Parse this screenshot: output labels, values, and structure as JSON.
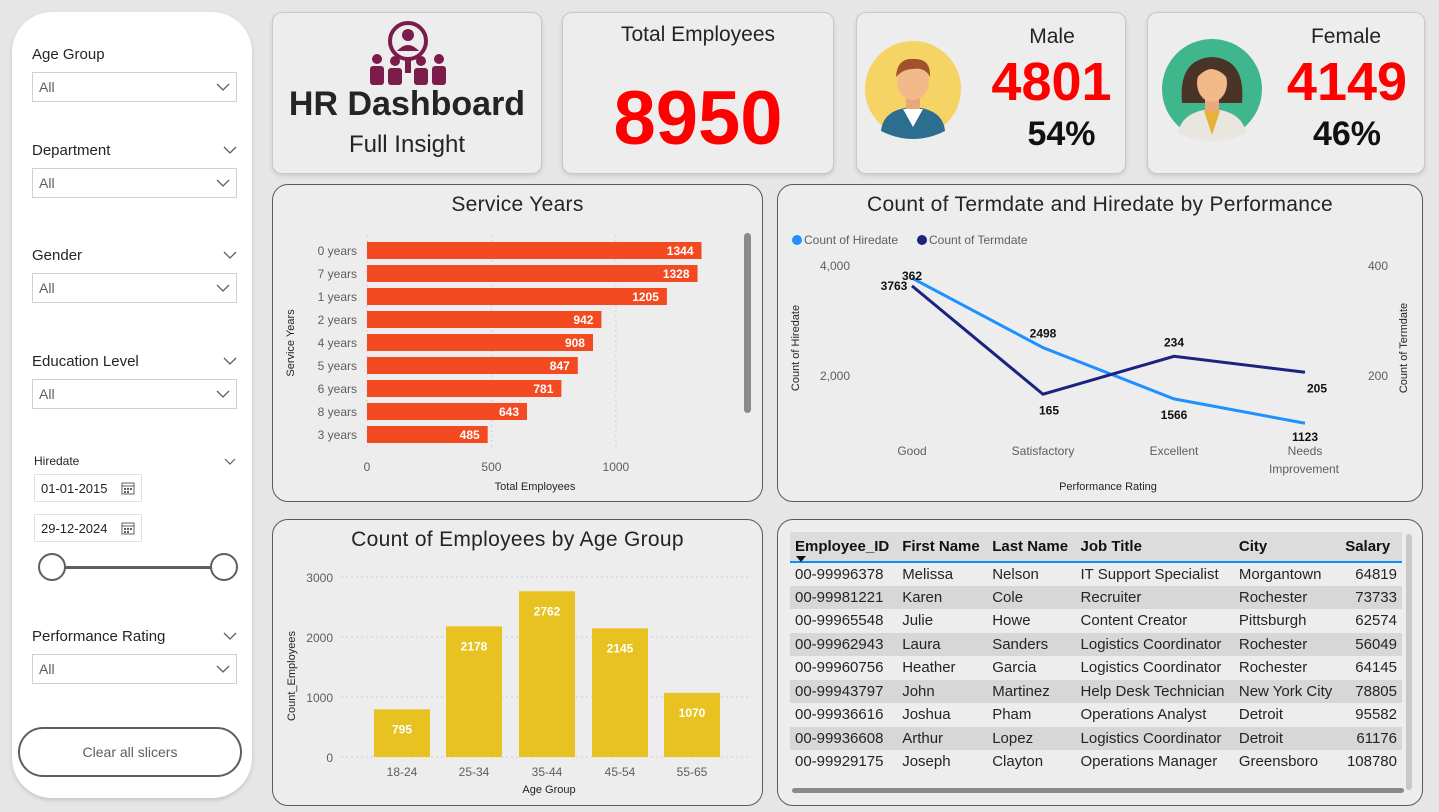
{
  "filters": {
    "age_group": {
      "label": "Age Group",
      "value": "All"
    },
    "department": {
      "label": "Department",
      "value": "All"
    },
    "gender": {
      "label": "Gender",
      "value": "All"
    },
    "education_level": {
      "label": "Education Level",
      "value": "All"
    },
    "hiredate": {
      "label": "Hiredate",
      "start": "01-01-2015",
      "end": "29-12-2024"
    },
    "performance_rating": {
      "label": "Performance Rating",
      "value": "All"
    },
    "clear_label": "Clear all slicers"
  },
  "header": {
    "title": "HR Dashboard",
    "subtitle": "Full Insight",
    "total_label": "Total Employees",
    "total_value": "8950",
    "male_label": "Male",
    "male_value": "4801",
    "male_pct": "54%",
    "female_label": "Female",
    "female_value": "4149",
    "female_pct": "46%"
  },
  "colors": {
    "bar_orange": "#f44a22",
    "bar_yellow": "#e8c220",
    "line_light": "#1e90ff",
    "line_dark": "#1a237e",
    "kpi_red": "#ff0000"
  },
  "chart_data": [
    {
      "type": "bar",
      "orientation": "horizontal",
      "title": "Service Years",
      "xlabel": "Total Employees",
      "ylabel": "Service Years",
      "categories": [
        "0 years",
        "7 years",
        "1 years",
        "2 years",
        "4 years",
        "5 years",
        "6 years",
        "8 years",
        "3 years"
      ],
      "values": [
        1344,
        1328,
        1205,
        942,
        908,
        847,
        781,
        643,
        485
      ],
      "xticks": [
        "0",
        "500",
        "1000"
      ],
      "xlim": [
        0,
        1350
      ]
    },
    {
      "type": "line",
      "title": "Count of Termdate and Hiredate by Performance",
      "xlabel": "Performance Rating",
      "ylabel": "Count of Hiredate",
      "y2label": "Count of Termdate",
      "categories": [
        "Good",
        "Satisfactory",
        "Excellent",
        "Needs Improvement"
      ],
      "series": [
        {
          "name": "Count of Hiredate",
          "axis": "left",
          "values": [
            3763,
            2498,
            1566,
            1123
          ],
          "labels": [
            "3763",
            "2498",
            "1566",
            "1123"
          ]
        },
        {
          "name": "Count of Termdate",
          "axis": "right",
          "values": [
            362,
            165,
            234,
            205
          ],
          "labels": [
            "362",
            "165",
            "234",
            "205"
          ]
        }
      ],
      "yticks": [
        "4,000",
        "2,000"
      ],
      "y2ticks": [
        "400",
        "200"
      ],
      "legend": "top-left"
    },
    {
      "type": "bar",
      "title": "Count of Employees by Age Group",
      "xlabel": "Age Group",
      "ylabel": "Count_Employees",
      "categories": [
        "18-24",
        "25-34",
        "35-44",
        "45-54",
        "55-65"
      ],
      "values": [
        795,
        2178,
        2762,
        2145,
        1070
      ],
      "yticks": [
        "3000",
        "2000",
        "1000",
        "0"
      ],
      "ylim": [
        0,
        3000
      ]
    }
  ],
  "table": {
    "columns": [
      "Employee_ID",
      "First Name",
      "Last Name",
      "Job Title",
      "City",
      "Salary"
    ],
    "rows": [
      [
        "00-99996378",
        "Melissa",
        "Nelson",
        "IT Support Specialist",
        "Morgantown",
        "64819"
      ],
      [
        "00-99981221",
        "Karen",
        "Cole",
        "Recruiter",
        "Rochester",
        "73733"
      ],
      [
        "00-99965548",
        "Julie",
        "Howe",
        "Content Creator",
        "Pittsburgh",
        "62574"
      ],
      [
        "00-99962943",
        "Laura",
        "Sanders",
        "Logistics Coordinator",
        "Rochester",
        "56049"
      ],
      [
        "00-99960756",
        "Heather",
        "Garcia",
        "Logistics Coordinator",
        "Rochester",
        "64145"
      ],
      [
        "00-99943797",
        "John",
        "Martinez",
        "Help Desk Technician",
        "New York City",
        "78805"
      ],
      [
        "00-99936616",
        "Joshua",
        "Pham",
        "Operations Analyst",
        "Detroit",
        "95582"
      ],
      [
        "00-99936608",
        "Arthur",
        "Lopez",
        "Logistics Coordinator",
        "Detroit",
        "61176"
      ],
      [
        "00-99929175",
        "Joseph",
        "Clayton",
        "Operations Manager",
        "Greensboro",
        "108780"
      ]
    ]
  }
}
